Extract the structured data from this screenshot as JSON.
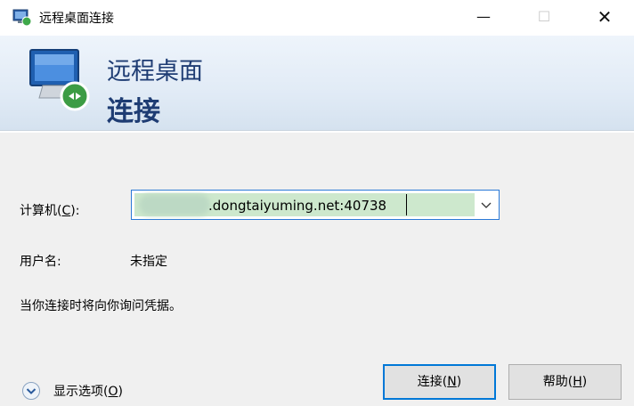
{
  "window": {
    "title": "远程桌面连接",
    "minimize": "—",
    "maximize": "☐",
    "close": "✕"
  },
  "banner": {
    "line1": "远程桌面",
    "line2": "连接"
  },
  "form": {
    "computer_label": "计算机(",
    "computer_label_key": "C",
    "computer_label_end": "):",
    "computer_value": ".dongtaiyuming.net:40738",
    "username_label": "用户名:",
    "username_value": "未指定",
    "hint": "当你连接时将向你询问凭据。"
  },
  "footer": {
    "options_label": "显示选项(",
    "options_key": "O",
    "options_end": ")",
    "connect_label": "连接(",
    "connect_key": "N",
    "connect_end": ")",
    "help_label": "帮助(",
    "help_key": "H",
    "help_end": ")"
  },
  "icons": [
    "rdp-app-icon",
    "rdp-monitor-icon",
    "chevron-down-icon",
    "expand-options-icon"
  ],
  "colors": {
    "banner_text": "#1e3c73",
    "focus_border": "#0078d7",
    "selection": "#cde8cd"
  }
}
